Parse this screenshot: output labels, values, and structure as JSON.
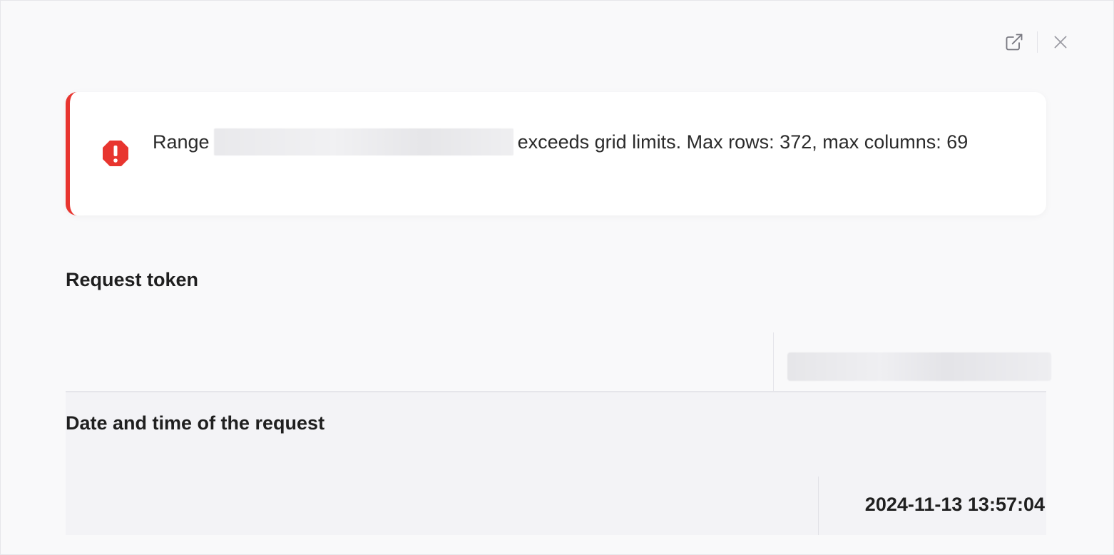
{
  "header": {
    "open_external_icon": "external-link-icon",
    "close_icon": "close-icon"
  },
  "alert": {
    "icon": "error-icon",
    "text_before": "Range",
    "text_after": "exceeds grid limits. Max rows: 372, max columns: 69",
    "accent_color": "#e8352f"
  },
  "request_token": {
    "label": "Request token"
  },
  "request_datetime": {
    "label": "Date and time of the request",
    "value": "2024-11-13 13:57:04"
  }
}
